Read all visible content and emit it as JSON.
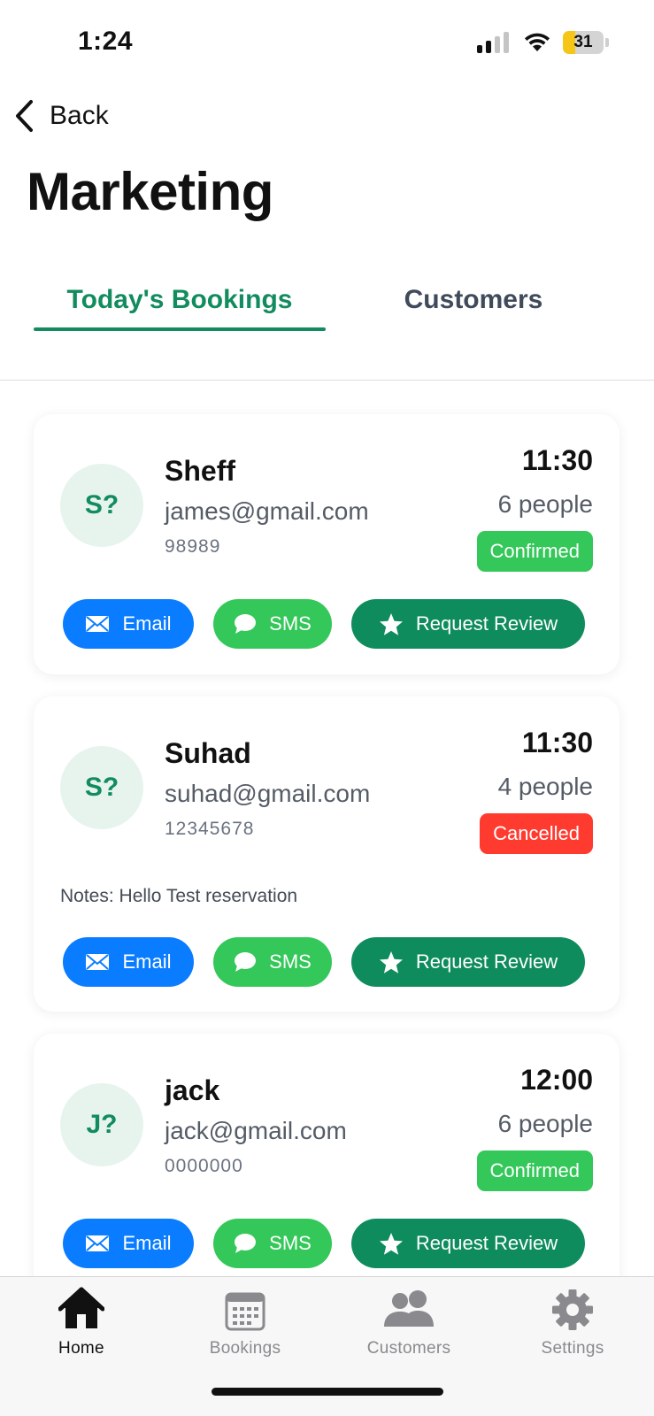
{
  "status_bar": {
    "time": "1:24",
    "battery": "31",
    "battery_level": 0.31
  },
  "nav": {
    "back_label": "Back"
  },
  "page": {
    "title": "Marketing"
  },
  "tabs": [
    {
      "label": "Today's Bookings",
      "active": true
    },
    {
      "label": "Customers",
      "active": false
    }
  ],
  "bookings": [
    {
      "initials": "S?",
      "name": "Sheff",
      "email": "james@gmail.com",
      "phone": "98989",
      "time": "11:30",
      "people": "6 people",
      "status": "Confirmed",
      "notes": ""
    },
    {
      "initials": "S?",
      "name": "Suhad",
      "email": "suhad@gmail.com",
      "phone": "12345678",
      "time": "11:30",
      "people": "4 people",
      "status": "Cancelled",
      "notes": "Notes: Hello Test reservation"
    },
    {
      "initials": "J?",
      "name": "jack",
      "email": "jack@gmail.com",
      "phone": "0000000",
      "time": "12:00",
      "people": "6 people",
      "status": "Confirmed",
      "notes": ""
    }
  ],
  "actions": {
    "email": "Email",
    "sms": "SMS",
    "review": "Request Review"
  },
  "tab_bar": [
    {
      "label": "Home",
      "icon": "home-icon",
      "active": true
    },
    {
      "label": "Bookings",
      "icon": "calendar-icon",
      "active": false
    },
    {
      "label": "Customers",
      "icon": "people-icon",
      "active": false
    },
    {
      "label": "Settings",
      "icon": "gear-icon",
      "active": false
    }
  ],
  "colors": {
    "accent": "#128c5e",
    "email_button": "#0a7cff",
    "sms_button": "#34c759",
    "review_button": "#0f8c5d",
    "confirmed": "#34c759",
    "cancelled": "#ff3b30"
  }
}
